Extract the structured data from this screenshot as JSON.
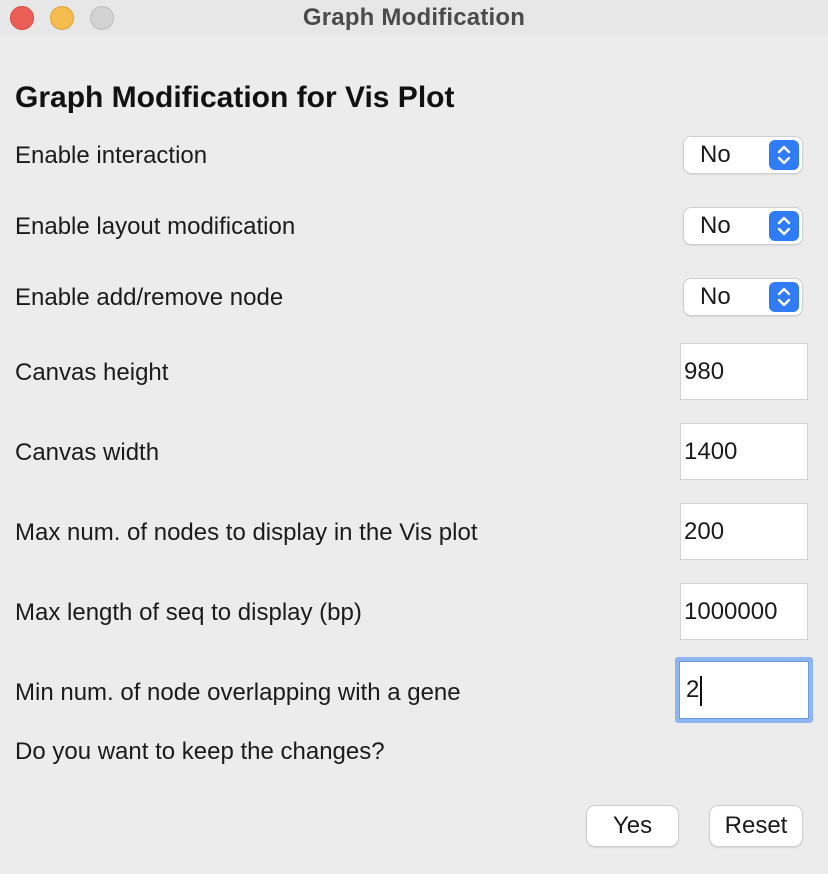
{
  "window": {
    "title": "Graph Modification"
  },
  "form": {
    "heading": "Graph Modification for Vis Plot",
    "popups": [
      {
        "label": "Enable interaction",
        "value": "No"
      },
      {
        "label": "Enable layout modification",
        "value": "No"
      },
      {
        "label": "Enable add/remove node",
        "value": "No"
      }
    ],
    "fields": [
      {
        "label": "Canvas height",
        "value": "980"
      },
      {
        "label": "Canvas width",
        "value": "1400"
      },
      {
        "label": "Max num. of nodes to display in the Vis plot",
        "value": "200"
      },
      {
        "label": "Max length of seq to display (bp)",
        "value": "1000000"
      },
      {
        "label": "Min num.  of node overlapping with a gene",
        "value": "2",
        "focused": true
      }
    ],
    "prompt": "Do you want to keep the changes?"
  },
  "buttons": {
    "yes": "Yes",
    "reset": "Reset"
  },
  "colors": {
    "accent": "#2f7cf6",
    "focus_ring": "#8fb6f2",
    "close": "#ec5f57",
    "minimize": "#f5bd4f",
    "zoom_disabled": "#d2d2d2"
  },
  "icons": {
    "popup_stepper": "up-down-chevron-icon"
  }
}
